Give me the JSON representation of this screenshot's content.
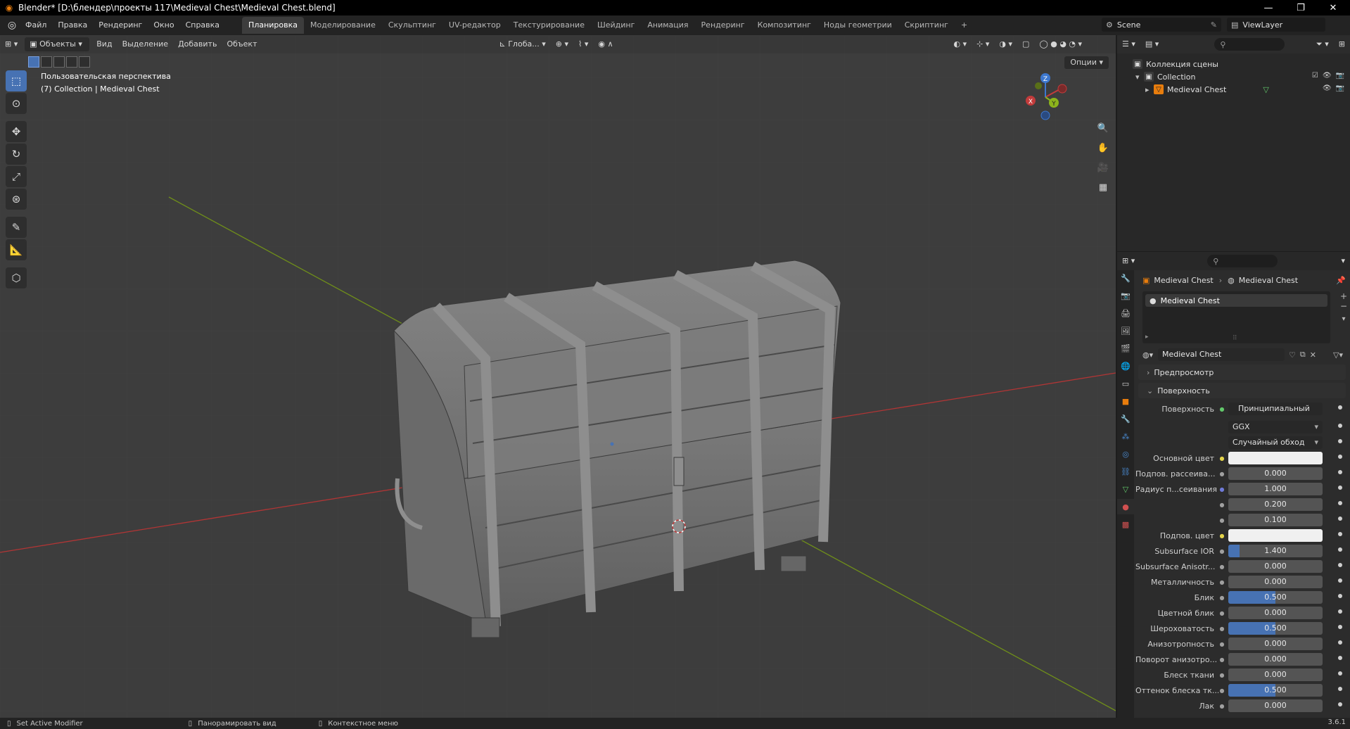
{
  "window": {
    "title": "Blender* [D:\\блендер\\проекты 117\\Medieval Chest\\Medieval Chest.blend]",
    "minimize": "—",
    "maximize": "❐",
    "close": "✕"
  },
  "menu": [
    "Файл",
    "Правка",
    "Рендеринг",
    "Окно",
    "Справка"
  ],
  "workspaces": [
    "Планировка",
    "Моделирование",
    "Скульптинг",
    "UV-редактор",
    "Текстурирование",
    "Шейдинг",
    "Анимация",
    "Рендеринг",
    "Композитинг",
    "Ноды геометрии",
    "Скриптинг"
  ],
  "workspace_add": "+",
  "scene": {
    "name": "Scene",
    "view_layer": "ViewLayer"
  },
  "viewport": {
    "mode": "Объекты",
    "header_menus": [
      "Вид",
      "Выделение",
      "Добавить",
      "Объект"
    ],
    "transform_orientation": "Глоба...",
    "options": "Опции",
    "perspective_label": "Пользовательская перспектива",
    "collection_label": "(7) Collection | Medieval Chest",
    "gizmo_axes": {
      "x": "X",
      "y": "Y",
      "z": "Z"
    }
  },
  "outliner": {
    "scene_collection": "Коллекция сцены",
    "collection": "Collection",
    "object": "Medieval Chest"
  },
  "properties": {
    "breadcrumb_object": "Medieval Chest",
    "breadcrumb_material": "Medieval Chest",
    "slot_name": "Medieval Chest",
    "material_name": "Medieval Chest",
    "panel_preview": "Предпросмотр",
    "panel_surface": "Поверхность",
    "rows": [
      {
        "label": "Поверхность",
        "value": "Принципиальный BSDF",
        "kind": "node"
      },
      {
        "label": "",
        "value": "GGX",
        "kind": "dropdown"
      },
      {
        "label": "",
        "value": "Случайный обход",
        "kind": "dropdown"
      },
      {
        "label": "Основной цвет",
        "value": "",
        "kind": "color"
      },
      {
        "label": "Подпов. рассеива...",
        "value": "0.000",
        "kind": "number",
        "fill": 0
      },
      {
        "label": "Радиус п...сеивания",
        "value": "1.000",
        "kind": "number",
        "fill": 0
      },
      {
        "label": "",
        "value": "0.200",
        "kind": "number",
        "fill": 0
      },
      {
        "label": "",
        "value": "0.100",
        "kind": "number",
        "fill": 0
      },
      {
        "label": "Подпов. цвет",
        "value": "",
        "kind": "color"
      },
      {
        "label": "Subsurface IOR",
        "value": "1.400",
        "kind": "number",
        "fill": 0.12
      },
      {
        "label": "Subsurface Anisotr...",
        "value": "0.000",
        "kind": "number",
        "fill": 0
      },
      {
        "label": "Металличность",
        "value": "0.000",
        "kind": "number",
        "fill": 0
      },
      {
        "label": "Блик",
        "value": "0.500",
        "kind": "number",
        "fill": 0.5
      },
      {
        "label": "Цветной блик",
        "value": "0.000",
        "kind": "number",
        "fill": 0
      },
      {
        "label": "Шероховатость",
        "value": "0.500",
        "kind": "number",
        "fill": 0.5
      },
      {
        "label": "Анизотропность",
        "value": "0.000",
        "kind": "number",
        "fill": 0
      },
      {
        "label": "Поворот анизотро...",
        "value": "0.000",
        "kind": "number",
        "fill": 0
      },
      {
        "label": "Блеск ткани",
        "value": "0.000",
        "kind": "number",
        "fill": 0
      },
      {
        "label": "Оттенок блеска тк...",
        "value": "0.500",
        "kind": "number",
        "fill": 0.5
      },
      {
        "label": "Лак",
        "value": "0.000",
        "kind": "number",
        "fill": 0
      }
    ]
  },
  "status": {
    "left": "Set Active Modifier",
    "middle": "Панорамировать вид",
    "right": "Контекстное меню",
    "version": "3.6.1"
  },
  "colors": {
    "accent": "#4772b3",
    "viewport_bg": "#3d3d3d",
    "axis_x": "#c23b3b",
    "axis_y": "#7a9a1a",
    "object_orange": "#e87d0d"
  }
}
